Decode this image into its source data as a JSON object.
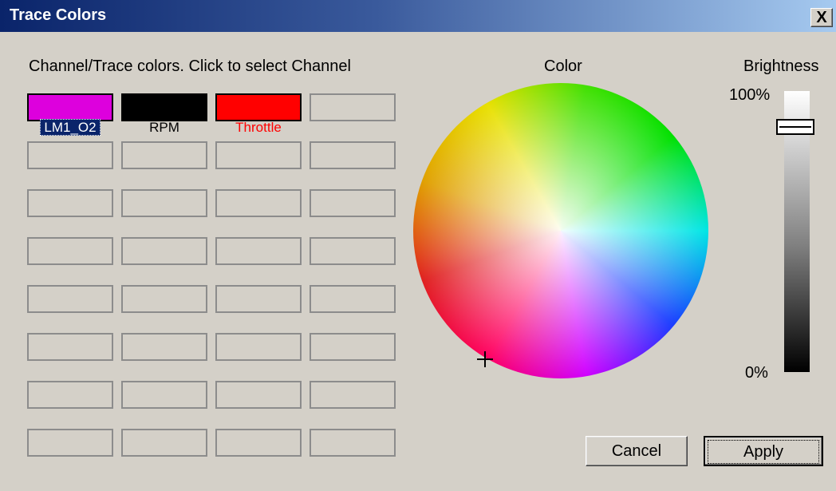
{
  "window": {
    "title": "Trace Colors",
    "close_label": "X"
  },
  "hint": "Channel/Trace colors. Click to select Channel",
  "channels": [
    {
      "name": "LM1_O2",
      "color": "#dd00dd",
      "label_color": "#ffffff",
      "selected": true
    },
    {
      "name": "RPM",
      "color": "#000000",
      "label_color": "#000000",
      "selected": false
    },
    {
      "name": "Throttle",
      "color": "#ff0000",
      "label_color": "#ff0000",
      "selected": false
    }
  ],
  "empty_slot_count": 29,
  "color_section": {
    "label": "Color",
    "selected_color": "#dd00dd"
  },
  "brightness": {
    "label": "Brightness",
    "max_label": "100%",
    "min_label": "0%",
    "level": 0.9
  },
  "buttons": {
    "cancel": "Cancel",
    "apply": "Apply"
  }
}
